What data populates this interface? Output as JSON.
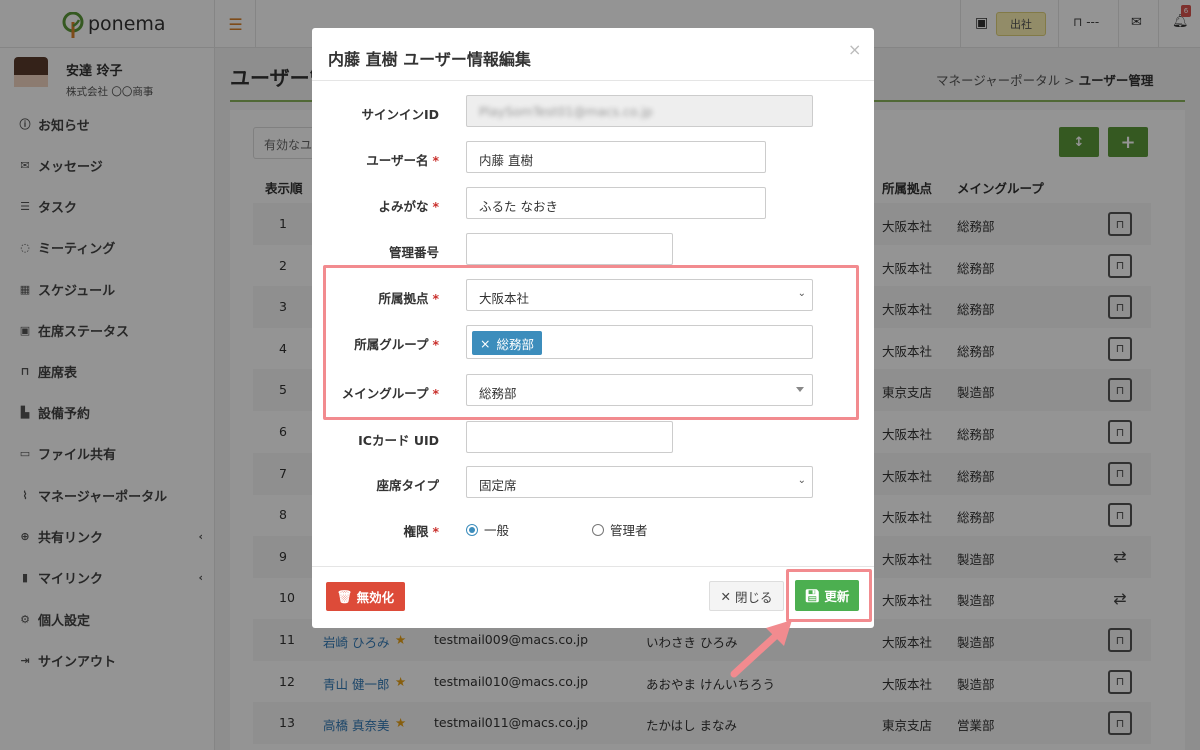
{
  "app": {
    "brand": "ponema"
  },
  "user": {
    "name": "安達 玲子",
    "company": "株式会社 〇〇商事"
  },
  "sidebar": {
    "items": [
      {
        "label": "お知らせ",
        "icon": "info-icon"
      },
      {
        "label": "メッセージ",
        "icon": "mail-icon"
      },
      {
        "label": "タスク",
        "icon": "task-list-icon"
      },
      {
        "label": "ミーティング",
        "icon": "chat-icon"
      },
      {
        "label": "スケジュール",
        "icon": "calendar-icon"
      },
      {
        "label": "在席ステータス",
        "icon": "presence-icon"
      },
      {
        "label": "座席表",
        "icon": "seat-icon"
      },
      {
        "label": "設備予約",
        "icon": "equipment-icon"
      },
      {
        "label": "ファイル共有",
        "icon": "folder-icon"
      },
      {
        "label": "マネージャーポータル",
        "icon": "chart-icon"
      },
      {
        "label": "共有リンク",
        "icon": "globe-icon",
        "chevron": "‹"
      },
      {
        "label": "マイリンク",
        "icon": "bookmark-icon",
        "chevron": "‹"
      },
      {
        "label": "個人設定",
        "icon": "gear-icon"
      },
      {
        "label": "サインアウト",
        "icon": "signout-icon"
      }
    ]
  },
  "topbar": {
    "status_button": "出社",
    "seat_label": "---",
    "notification_count": "6"
  },
  "page": {
    "title": "ユーザー管理",
    "breadcrumb_parent": "マネージャーポータル",
    "breadcrumb_sep": ">",
    "breadcrumb_current": "ユーザー管理",
    "filter_placeholder": "有効なユーザー",
    "sort_button": "↕",
    "add_button": "+"
  },
  "table": {
    "headers": {
      "order": "表示順",
      "site": "所属拠点",
      "main_group": "メイングループ"
    },
    "rows": [
      {
        "order": "1",
        "site": "大阪本社",
        "group": "総務部",
        "action": "seat"
      },
      {
        "order": "2",
        "site": "大阪本社",
        "group": "総務部",
        "action": "seat"
      },
      {
        "order": "3",
        "site": "大阪本社",
        "group": "総務部",
        "action": "seat"
      },
      {
        "order": "4",
        "site": "大阪本社",
        "group": "総務部",
        "action": "seat"
      },
      {
        "order": "5",
        "site": "東京支店",
        "group": "製造部",
        "action": "seat"
      },
      {
        "order": "6",
        "site": "大阪本社",
        "group": "総務部",
        "action": "seat"
      },
      {
        "order": "7",
        "site": "大阪本社",
        "group": "総務部",
        "action": "seat"
      },
      {
        "order": "8",
        "site": "大阪本社",
        "group": "総務部",
        "action": "seat"
      },
      {
        "order": "9",
        "site": "大阪本社",
        "group": "製造部",
        "action": "swap"
      },
      {
        "order": "10",
        "site": "大阪本社",
        "group": "製造部",
        "action": "swap"
      },
      {
        "order": "11",
        "name": "岩崎 ひろみ",
        "email": "testmail009@macs.co.jp",
        "kana": "いわさき ひろみ",
        "site": "大阪本社",
        "group": "製造部",
        "action": "seat"
      },
      {
        "order": "12",
        "name": "青山 健一郎",
        "email": "testmail010@macs.co.jp",
        "kana": "あおやま けんいちろう",
        "site": "大阪本社",
        "group": "製造部",
        "action": "seat"
      },
      {
        "order": "13",
        "name": "高橋 真奈美",
        "email": "testmail011@macs.co.jp",
        "kana": "たかはし まなみ",
        "site": "東京支店",
        "group": "営業部",
        "action": "seat"
      }
    ]
  },
  "modal": {
    "title": "内藤 直樹 ユーザー情報編集",
    "close": "×",
    "fields": {
      "signin_id": {
        "label": "サインインID",
        "value": "PlaySomTest01@macs.co.jp"
      },
      "user_name": {
        "label": "ユーザー名",
        "value": "内藤 直樹"
      },
      "kana": {
        "label": "よみがな",
        "value": "ふるた なおき"
      },
      "admin_no": {
        "label": "管理番号",
        "value": ""
      },
      "site": {
        "label": "所属拠点",
        "value": "大阪本社"
      },
      "groups": {
        "label": "所属グループ",
        "tag": "総務部"
      },
      "main_group": {
        "label": "メイングループ",
        "value": "総務部"
      },
      "ic_card": {
        "label": "ICカード UID",
        "value": ""
      },
      "seat_type": {
        "label": "座席タイプ",
        "value": "固定席"
      },
      "role": {
        "label": "権限",
        "options": [
          "一般",
          "管理者"
        ],
        "selected": "一般"
      }
    },
    "buttons": {
      "disable": "無効化",
      "close": "閉じる",
      "update": "更新"
    }
  },
  "colors": {
    "accent_green": "#4caf50",
    "highlight": "#f28b8f",
    "danger": "#dd4b39",
    "link": "#337ab7"
  }
}
